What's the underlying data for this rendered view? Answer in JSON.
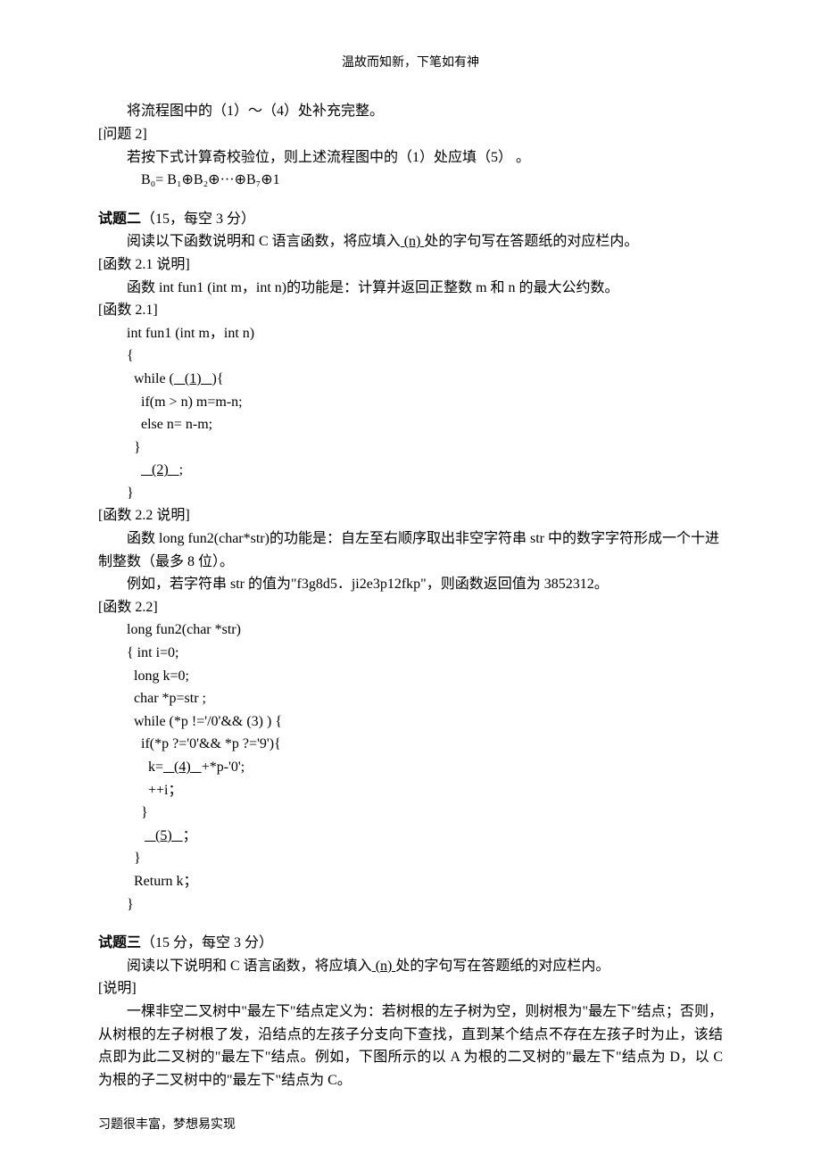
{
  "header": "温故而知新，下笔如有神",
  "footer": "习题很丰富，梦想易实现",
  "p1": "将流程图中的（1）～（4）处补充完整。",
  "q2_title": "[问题 2]",
  "q2_p1": "若按下式计算奇校验位，则上述流程图中的（1）处应填（5）  。",
  "q2_formula": "B₀= B₁⊕B₂⊕···⊕B₇⊕1",
  "t2_title": "试题二",
  "t2_score": "（15，每空 3 分）",
  "t2_intro_a": "阅读以下函数说明和 C 语言函数，将应填入",
  "t2_intro_blank": "   (n)   ",
  "t2_intro_b": "处的字句写在答题纸的对应栏内。",
  "f21_desc_title": "[函数 2.1 说明]",
  "f21_desc": "函数 int fun1 (int m，int n)的功能是：计算并返回正整数 m 和 n 的最大公约数。",
  "f21_title": "[函数 2.1]",
  "f21_l1": "int fun1 (int m，int n)",
  "f21_l2": "{",
  "f21_l3a": "  while (",
  "f21_l3_blank": "   (1)   ",
  "f21_l3b": "){",
  "f21_l4": "    if(m > n) m=m-n;",
  "f21_l5": "    else n= n-m;",
  "f21_l6": "  }",
  "f21_l7a": "    ",
  "f21_l7_blank": "   (2)   ",
  "f21_l7b": ";",
  "f21_l8": "}",
  "f22_desc_title": "[函数 2.2 说明]",
  "f22_desc1": "函数 long fun2(char*str)的功能是：自左至右顺序取出非空字符串 str 中的数字字符形成一个十进制整数（最多 8 位）。",
  "f22_desc2": "例如，若字符串 str 的值为\"f3g8d5．ji2e3p12fkp\"，则函数返回值为 3852312。",
  "f22_title": "[函数 2.2]",
  "f22_l1": "long fun2(char *str)",
  "f22_l2": "{ int i=0;",
  "f22_l3": "  long k=0;",
  "f22_l4": "  char *p=str ;",
  "f22_l5": "  while (*p !='/0'&& (3) ) {",
  "f22_l6": "    if(*p ?='0'&& *p ?='9'){",
  "f22_l7a": "      k=",
  "f22_l7_blank": "   (4)   ",
  "f22_l7b": "+*p-'0';",
  "f22_l8": "      ++i；",
  "f22_l9": "    }",
  "f22_l10a": "     ",
  "f22_l10_blank": "   (5)   ",
  "f22_l10b": "；",
  "f22_l11": "  }",
  "f22_l12": "  Return k；",
  "f22_l13": "}",
  "t3_title": "试题三",
  "t3_score": "（15 分，每空 3 分）",
  "t3_intro_a": "阅读以下说明和 C 语言函数，将应填入",
  "t3_intro_blank": "   (n)   ",
  "t3_intro_b": "处的字句写在答题纸的对应栏内。",
  "t3_desc_title": "[说明]",
  "t3_desc": "一棵非空二叉树中\"最左下\"结点定义为：若树根的左子树为空，则树根为\"最左下\"结点；否则，从树根的左子树根了发，沿结点的左孩子分支向下查找，直到某个结点不存在左孩子时为止，该结点即为此二叉树的\"最左下\"结点。例如，下图所示的以 A 为根的二叉树的\"最左下\"结点为 D，以 C 为根的子二叉树中的\"最左下\"结点为 C。"
}
